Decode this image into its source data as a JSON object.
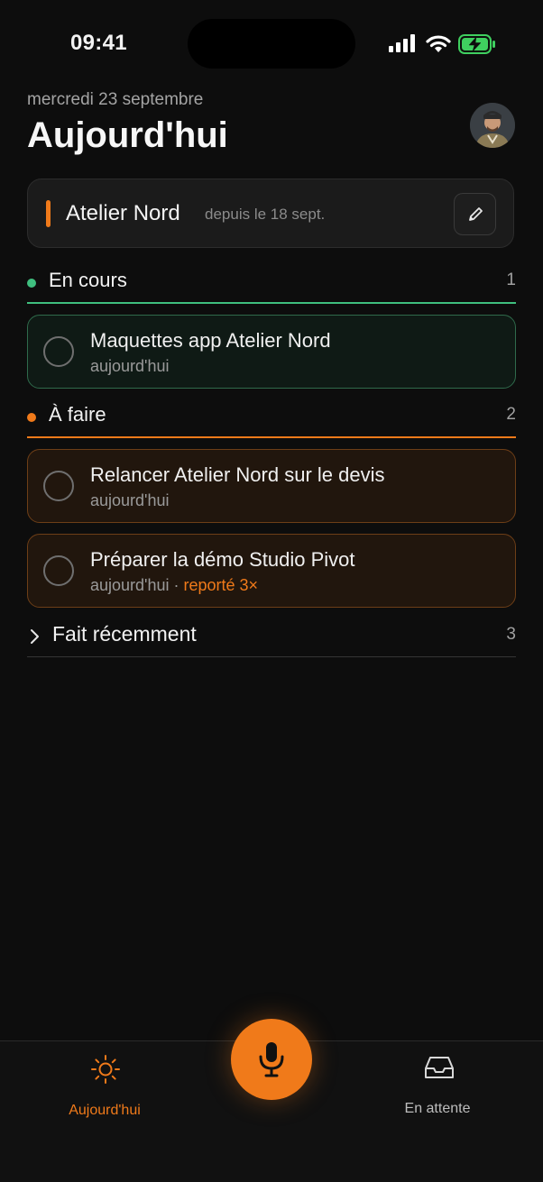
{
  "status_bar": {
    "time": "09:41"
  },
  "header": {
    "date": "mercredi 23 septembre",
    "title": "Aujourd'hui"
  },
  "project": {
    "name": "Atelier Nord",
    "since": "depuis le 18 sept.",
    "accent": "#f07a1a"
  },
  "sections": {
    "in_progress": {
      "label": "En cours",
      "count": "1",
      "color": "#3fbf7f",
      "tasks": [
        {
          "title": "Maquettes app Atelier Nord",
          "due": "aujourd'hui"
        }
      ]
    },
    "todo": {
      "label": "À faire",
      "count": "2",
      "color": "#f07a1a",
      "tasks": [
        {
          "title": "Relancer Atelier Nord sur le devis",
          "due": "aujourd'hui"
        },
        {
          "title": "Préparer la démo Studio Pivot",
          "due": "aujourd'hui",
          "separator": " · ",
          "postponed": "reporté 3×"
        }
      ]
    },
    "done_recently": {
      "label": "Fait récemment",
      "count": "3"
    }
  },
  "tab_bar": {
    "today_label": "Aujourd'hui",
    "waiting_label": "En attente",
    "today_icon": "sun-icon",
    "waiting_icon": "inbox-tray-icon",
    "mic_icon": "microphone-icon"
  }
}
